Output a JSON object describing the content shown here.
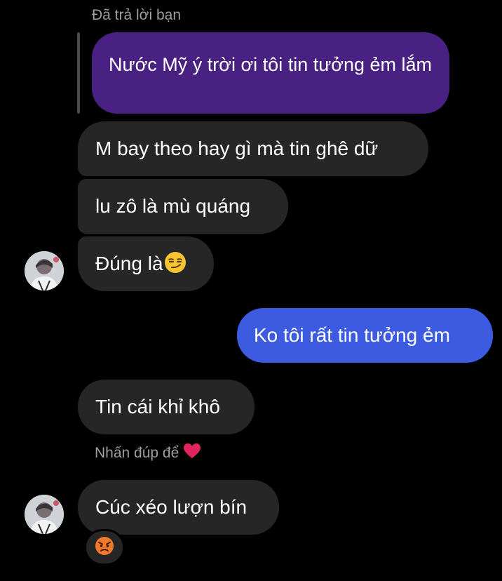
{
  "reply_header": "Đã trả lời bạn",
  "quoted_message": "Nước Mỹ ý trời ơi tôi tin tưởng ẻm lắm",
  "messages": [
    {
      "text": "M bay theo hay gì mà tin ghê dữ"
    },
    {
      "text": "lu zô là mù quáng"
    },
    {
      "text": "Đúng là"
    },
    {
      "text": "Ko tôi rất tin tưởng ẻm"
    },
    {
      "text": "Tin cái khỉ khô"
    },
    {
      "text": "Cúc xéo lượn bín"
    }
  ],
  "double_tap_hint": "Nhấn đúp để",
  "icons": {
    "smirk": "smirking-face-icon",
    "heart": "heart-icon",
    "angry": "angry-face-icon"
  },
  "colors": {
    "background": "#000000",
    "received_bubble": "#262626",
    "sent_bubble": "#3d5be0",
    "quoted_bubble": "#482182",
    "secondary_text": "#9e9e9e",
    "heart": "#e0245e"
  }
}
